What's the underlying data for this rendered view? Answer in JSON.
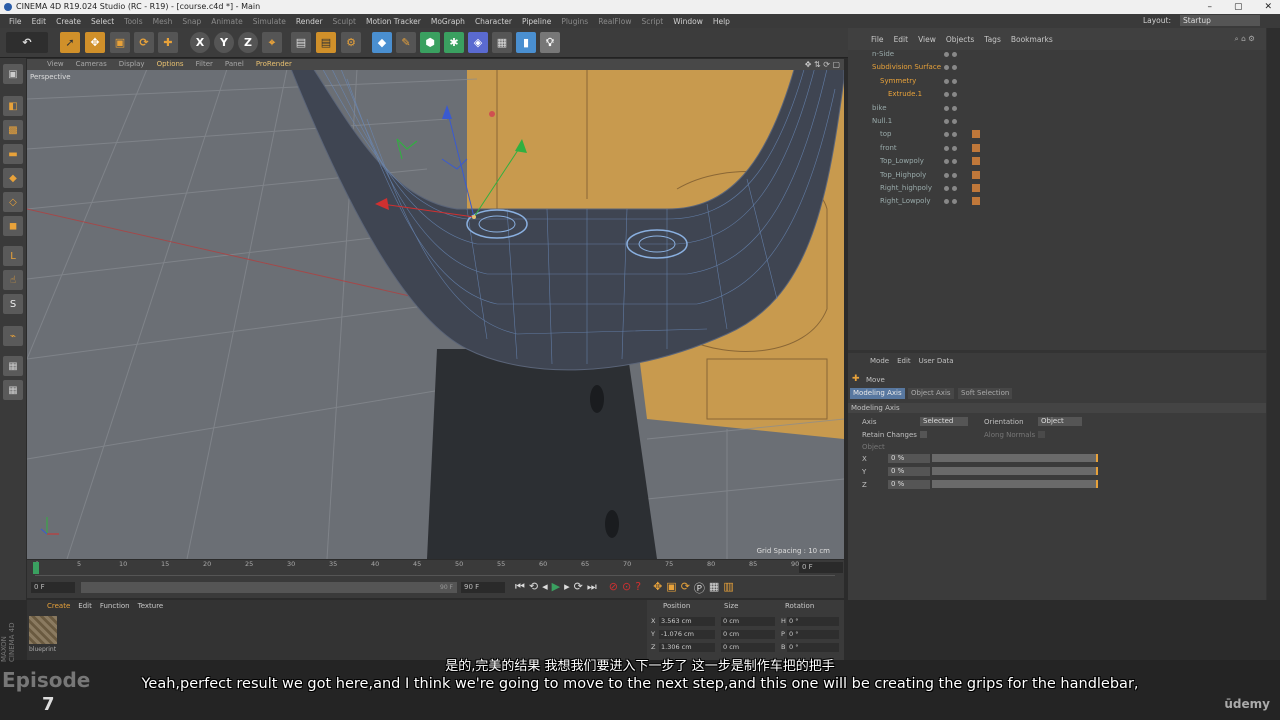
{
  "window": {
    "title": "CINEMA 4D R19.024 Studio (RC - R19) - [course.c4d *] - Main",
    "controls": [
      "–",
      "▢",
      "✕"
    ]
  },
  "menubar": {
    "items": [
      "File",
      "Edit",
      "Create",
      "Select",
      "Tools",
      "Mesh",
      "Snap",
      "Animate",
      "Simulate",
      "Render",
      "Sculpt",
      "Motion Tracker",
      "MoGraph",
      "Character",
      "Pipeline",
      "Plugins",
      "RealFlow",
      "Script",
      "Window",
      "Help"
    ],
    "layout_label": "Layout:",
    "layout_value": "Startup"
  },
  "viewport": {
    "menu": [
      "View",
      "Cameras",
      "Display",
      "Options",
      "Filter",
      "Panel",
      "ProRender"
    ],
    "label": "Perspective",
    "grid_spacing": "Grid Spacing : 10 cm"
  },
  "timeline": {
    "ticks": [
      "0",
      "5",
      "10",
      "15",
      "20",
      "25",
      "30",
      "35",
      "40",
      "45",
      "50",
      "55",
      "60",
      "65",
      "70",
      "75",
      "80",
      "85",
      "90"
    ],
    "frame_field": "0 F",
    "start_field": "0 F",
    "end_field": "90 F",
    "end_field2": "90 F"
  },
  "object_manager": {
    "menu": [
      "File",
      "Edit",
      "View",
      "Objects",
      "Tags",
      "Bookmarks"
    ],
    "objects": [
      {
        "name": "n-Side",
        "indent": 0,
        "selected": false
      },
      {
        "name": "Subdivision Surface",
        "indent": 0,
        "selected": true
      },
      {
        "name": "Symmetry",
        "indent": 1,
        "selected": true
      },
      {
        "name": "Extrude.1",
        "indent": 2,
        "selected": true
      },
      {
        "name": "bike",
        "indent": 0,
        "selected": false
      },
      {
        "name": "Null.1",
        "indent": 0,
        "selected": false
      },
      {
        "name": "top",
        "indent": 1,
        "selected": false
      },
      {
        "name": "front",
        "indent": 1,
        "selected": false
      },
      {
        "name": "Top_Lowpoly",
        "indent": 1,
        "selected": false
      },
      {
        "name": "Top_Highpoly",
        "indent": 1,
        "selected": false
      },
      {
        "name": "Right_highpoly",
        "indent": 1,
        "selected": false
      },
      {
        "name": "Right_Lowpoly",
        "indent": 1,
        "selected": false
      }
    ]
  },
  "attributes": {
    "menu": [
      "Mode",
      "Edit",
      "User Data"
    ],
    "tool_name": "Move",
    "tabs": [
      "Modeling Axis",
      "Object Axis",
      "Soft Selection"
    ],
    "section": "Modeling Axis",
    "axis_label": "Axis",
    "axis_value": "Selected",
    "orientation_label": "Orientation",
    "orientation_value": "Object",
    "retain_label": "Retain Changes",
    "along_normals_label": "Along Normals",
    "object_label": "Object",
    "x_label": "X",
    "x_value": "0 %",
    "y_label": "Y",
    "y_value": "0 %",
    "z_label": "Z",
    "z_value": "0 %"
  },
  "material_manager": {
    "menu": [
      "Create",
      "Edit",
      "Function",
      "Texture"
    ],
    "material_name": "blueprint"
  },
  "coordinates": {
    "headers": [
      "Position",
      "Size",
      "Rotation"
    ],
    "rows": [
      {
        "axis": "X",
        "pos": "3.563 cm",
        "size": "0 cm",
        "rot_label": "H",
        "rot": "0 °"
      },
      {
        "axis": "Y",
        "pos": "-1.076 cm",
        "size": "0 cm",
        "rot_label": "P",
        "rot": "0 °"
      },
      {
        "axis": "Z",
        "pos": "1.306 cm",
        "size": "0 cm",
        "rot_label": "B",
        "rot": "0 °"
      }
    ]
  },
  "subtitles": {
    "chinese": "是的,完美的结果 我想我们要进入下一步了 这一步是制作车把的把手",
    "english": "Yeah,perfect result we got here,and I think we're going to move to the next step,and this one will be creating the grips for the handlebar,"
  },
  "branding": {
    "episode": "Episode",
    "episode_number": "7",
    "maxon": "MAXON CINEMA 4D",
    "udemy": "ūdemy"
  },
  "colors": {
    "accent": "#e8a23a",
    "selected_tab": "#5878a0",
    "mesh": "#3f4552",
    "backdrop": "#c89a4e"
  }
}
